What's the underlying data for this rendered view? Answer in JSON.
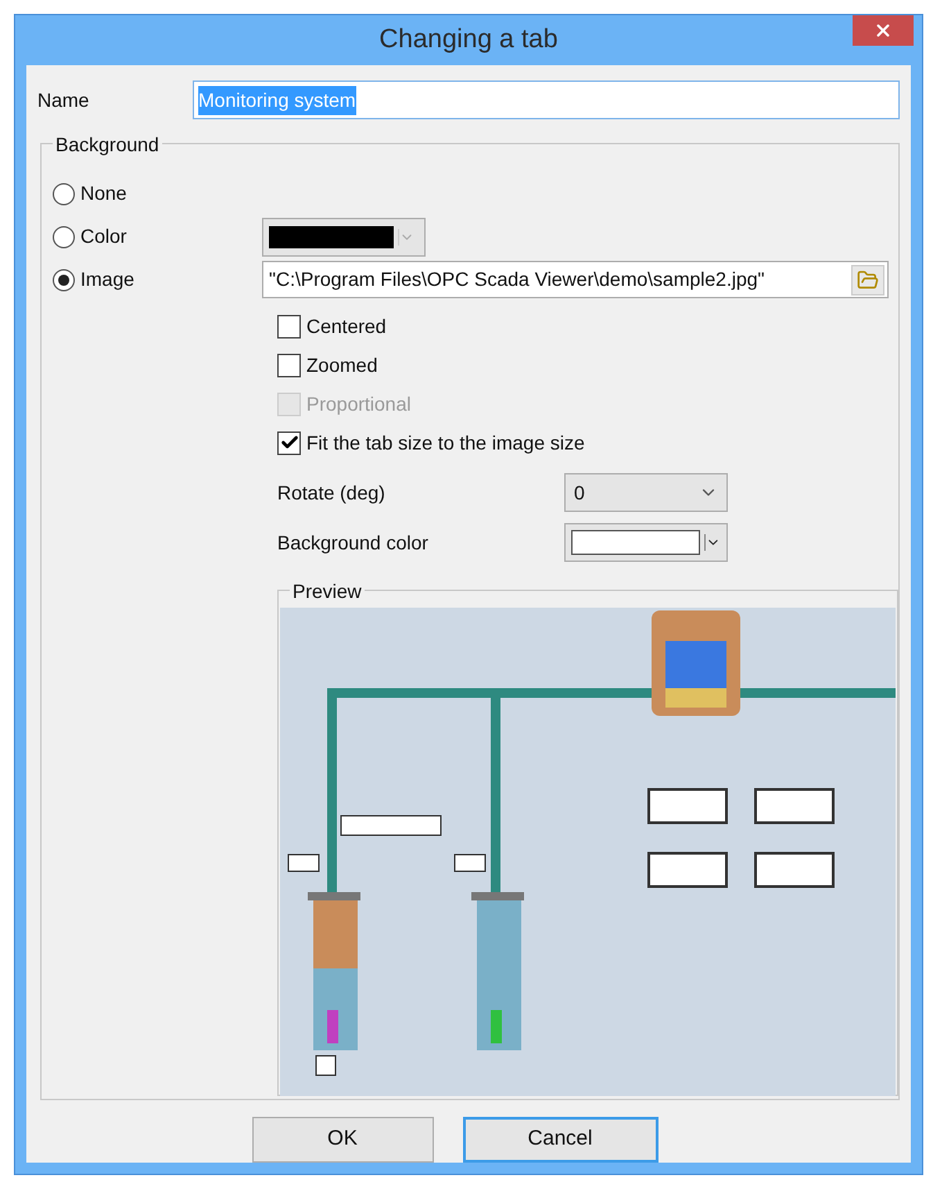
{
  "window": {
    "title": "Changing a tab"
  },
  "name_field": {
    "label": "Name",
    "value": "Monitoring system",
    "text_selected": true
  },
  "background": {
    "title": "Background",
    "options": [
      {
        "label": "None",
        "selected": false
      },
      {
        "label": "Color",
        "selected": false
      },
      {
        "label": "Image",
        "selected": true
      }
    ],
    "color_picker": {
      "color": "#000000",
      "disabled": true
    },
    "image_path": {
      "value": "\"C:\\Program Files\\OPC Scada Viewer\\demo\\sample2.jpg\""
    },
    "checkboxes": [
      {
        "label": "Centered",
        "checked": false,
        "disabled": false
      },
      {
        "label": "Zoomed",
        "checked": false,
        "disabled": false
      },
      {
        "label": "Proportional",
        "checked": false,
        "disabled": true
      },
      {
        "label": "Fit the tab size to the image size",
        "checked": true,
        "disabled": false
      }
    ],
    "rotate": {
      "label": "Rotate (deg)",
      "value": "0"
    },
    "background_color": {
      "label": "Background color",
      "color": "#ffffff"
    },
    "preview": {
      "title": "Preview"
    }
  },
  "buttons": [
    {
      "label": "OK",
      "focused": false
    },
    {
      "label": "Cancel",
      "focused": true
    }
  ]
}
